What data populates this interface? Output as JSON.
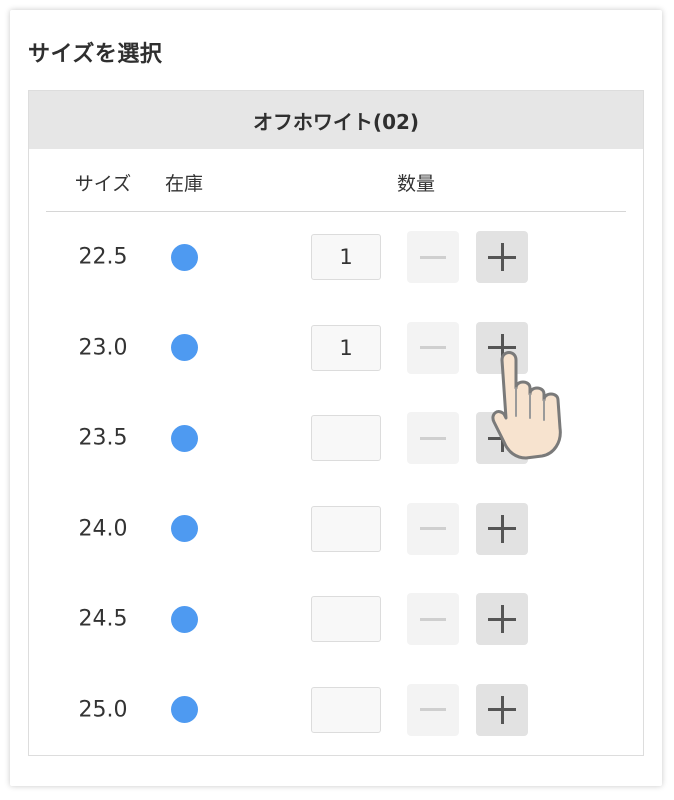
{
  "title": "サイズを選択",
  "color_variant": "オフホワイト(02)",
  "columns": {
    "size": "サイズ",
    "stock": "在庫",
    "quantity": "数量"
  },
  "rows": [
    {
      "size": "22.5",
      "stock_color": "#4e9af1",
      "quantity": "1"
    },
    {
      "size": "23.0",
      "stock_color": "#4e9af1",
      "quantity": "1"
    },
    {
      "size": "23.5",
      "stock_color": "#4e9af1",
      "quantity": ""
    },
    {
      "size": "24.0",
      "stock_color": "#4e9af1",
      "quantity": ""
    },
    {
      "size": "24.5",
      "stock_color": "#4e9af1",
      "quantity": ""
    },
    {
      "size": "25.0",
      "stock_color": "#4e9af1",
      "quantity": ""
    }
  ],
  "icons": {
    "decrement": "minus-icon",
    "increment": "plus-icon",
    "pointer": "pointing-hand-icon"
  },
  "colors": {
    "stock_available": "#4e9af1",
    "header_bg": "#e6e6e6",
    "increment_button_bg": "#e2e2e2",
    "decrement_button_bg": "#f3f3f3"
  }
}
